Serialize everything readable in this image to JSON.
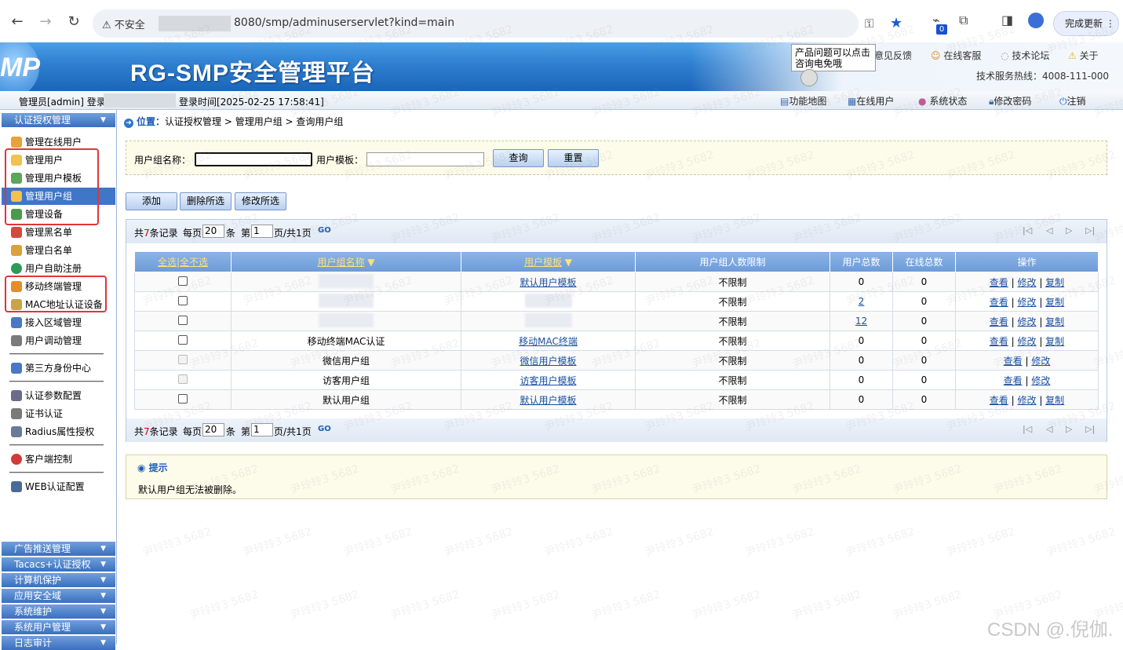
{
  "browser": {
    "security_label": "不安全",
    "url": "8080/smp/adminuserservlet?kind=main",
    "ext_badge": "0",
    "update_label": "完成更新"
  },
  "app": {
    "logo_text": "MP",
    "title": "RG-SMP安全管理平台",
    "header_links": [
      "意见反馈",
      "在线客服",
      "技术论坛",
      "关于"
    ],
    "hotline": "技术服务热线：4008-111-000",
    "tooltip": "产品问题可以点击咨询电免哦"
  },
  "status": {
    "admin": "管理员[admin] 登录IP",
    "login_time": "登录时间[2025-02-25 17:58:41]",
    "links": [
      "功能地图",
      "在线用户",
      "系统状态",
      "修改密码",
      "注销"
    ]
  },
  "sidebar": {
    "top_section": "认证授权管理",
    "items": [
      {
        "label": "管理在线用户",
        "color": "#e9a23b"
      },
      {
        "label": "管理用户",
        "color": "#f2c14e"
      },
      {
        "label": "管理用户模板",
        "color": "#5aa65a"
      },
      {
        "label": "管理用户组",
        "color": "#f2c14e"
      },
      {
        "label": "管理设备",
        "color": "#4b9a4b"
      },
      {
        "label": "管理黑名单",
        "color": "#d24a3a"
      },
      {
        "label": "管理白名单",
        "color": "#d9a23a"
      },
      {
        "label": "用户自助注册",
        "color": "#2f9a58"
      },
      {
        "label": "移动终端管理",
        "color": "#e88c2a"
      },
      {
        "label": "MAC地址认证设备",
        "color": "#c9a24a"
      },
      {
        "label": "接入区域管理",
        "color": "#4a78c8"
      },
      {
        "label": "用户调动管理",
        "color": "#7a7a7a"
      },
      {
        "label": "第三方身份中心",
        "color": "#4a78c8"
      },
      {
        "label": "认证参数配置",
        "color": "#6a6a8a"
      },
      {
        "label": "证书认证",
        "color": "#7a7a7a"
      },
      {
        "label": "Radius属性授权",
        "color": "#6a7a9a"
      },
      {
        "label": "客户端控制",
        "color": "#d23a3a"
      },
      {
        "label": "WEB认证配置",
        "color": "#4a6a9a"
      }
    ],
    "bottom_sections": [
      "广告推送管理",
      "Tacacs+认证授权",
      "计算机保护",
      "应用安全域",
      "系统维护",
      "系统用户管理",
      "日志审计"
    ]
  },
  "breadcrumb": {
    "prefix": "位置：",
    "path": "认证授权管理 > 管理用户组 > 查询用户组"
  },
  "search": {
    "group_name_label": "用户组名称：",
    "template_label": "用户模板：",
    "query_label": "查询",
    "reset_label": "重置"
  },
  "actions": {
    "add": "添加",
    "delete_selected": "删除所选",
    "modify_selected": "修改所选"
  },
  "pagination": {
    "total_prefix": "共",
    "total": "7",
    "total_suffix": "条记录",
    "per_page_label": "每页",
    "per_page": "20",
    "per_page_unit": "条",
    "page_prefix": "第",
    "page": "1",
    "page_suffix": "页/共",
    "total_pages": "1",
    "pages_unit": "页",
    "go": "GO"
  },
  "table": {
    "headers": {
      "select_all": "全选",
      "select_none": "全不选",
      "group_name": "用户组名称",
      "template": "用户模板",
      "limit": "用户组人数限制",
      "user_total": "用户总数",
      "online_total": "在线总数",
      "ops": "操作"
    },
    "op_labels": {
      "view": "查看",
      "edit": "修改",
      "copy": "复制"
    },
    "rows": [
      {
        "name": "",
        "template": "默认用户模板",
        "limit": "不限制",
        "users": "0",
        "users_link": false,
        "online": "0",
        "disabled": false,
        "copy": true
      },
      {
        "name": "",
        "template": "",
        "limit": "不限制",
        "users": "2",
        "users_link": true,
        "online": "0",
        "disabled": false,
        "copy": true
      },
      {
        "name": "",
        "template": "",
        "limit": "不限制",
        "users": "12",
        "users_link": true,
        "online": "0",
        "disabled": false,
        "copy": true
      },
      {
        "name": "移动终端MAC认证",
        "template": "移动MAC终端",
        "limit": "不限制",
        "users": "0",
        "users_link": false,
        "online": "0",
        "disabled": false,
        "copy": true
      },
      {
        "name": "微信用户组",
        "template": "微信用户模板",
        "limit": "不限制",
        "users": "0",
        "users_link": false,
        "online": "0",
        "disabled": true,
        "copy": false
      },
      {
        "name": "访客用户组",
        "template": "访客用户模板",
        "limit": "不限制",
        "users": "0",
        "users_link": false,
        "online": "0",
        "disabled": true,
        "copy": false
      },
      {
        "name": "默认用户组",
        "template": "默认用户模板",
        "limit": "不限制",
        "users": "0",
        "users_link": false,
        "online": "0",
        "disabled": false,
        "copy": true
      }
    ]
  },
  "tip": {
    "title": "提示",
    "text": "默认用户组无法被删除。"
  },
  "watermark": "尹玲玲3 5682",
  "credit": "CSDN @.倪伽."
}
